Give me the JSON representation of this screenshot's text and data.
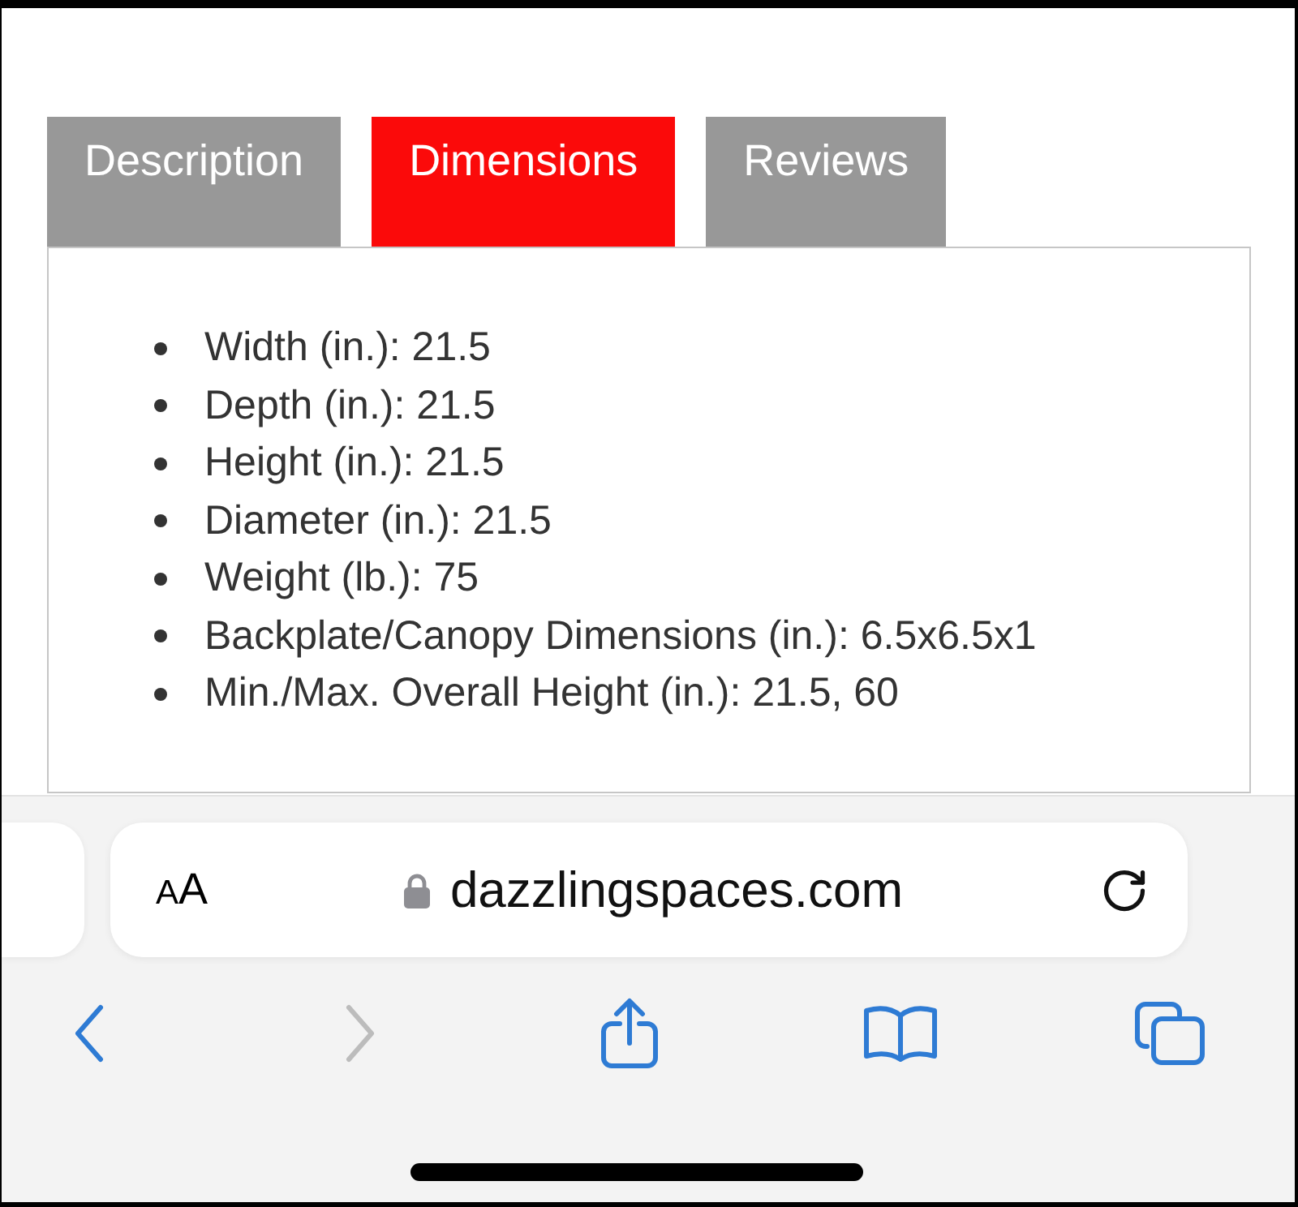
{
  "tabs": [
    {
      "label": "Description",
      "selected": false
    },
    {
      "label": "Dimensions",
      "selected": true
    },
    {
      "label": "Reviews",
      "selected": false
    }
  ],
  "specs": [
    "Width (in.): 21.5",
    "Depth (in.): 21.5",
    "Height (in.): 21.5",
    "Diameter (in.): 21.5",
    "Weight (lb.): 75",
    "Backplate/Canopy Dimensions (in.): 6.5x6.5x1",
    "Min./Max. Overall Height (in.): 21.5, 60"
  ],
  "browser": {
    "reader_button": "AA",
    "secure": true,
    "url": "dazzlingspaces.com",
    "toolbar": [
      {
        "kind": "back",
        "disabled": false
      },
      {
        "kind": "forward",
        "disabled": true
      },
      {
        "kind": "share",
        "disabled": false
      },
      {
        "kind": "bookmarks",
        "disabled": false
      },
      {
        "kind": "tabs",
        "disabled": false
      }
    ]
  }
}
